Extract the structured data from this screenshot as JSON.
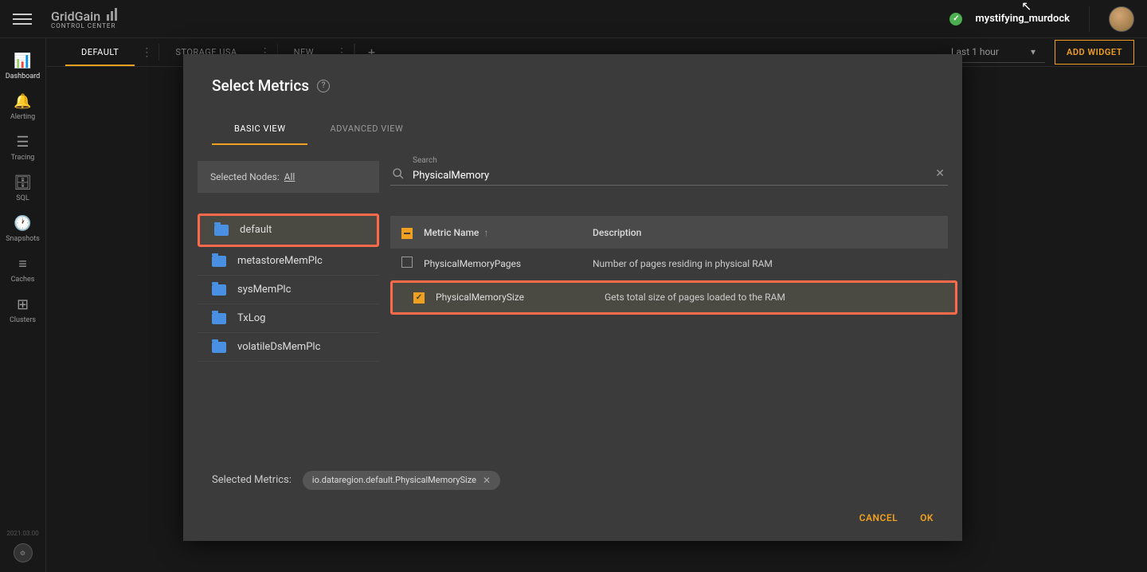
{
  "header": {
    "logo_main": "GridGain",
    "logo_sub": "CONTROL CENTER",
    "username": "mystifying_murdock"
  },
  "sidebar": {
    "items": [
      {
        "label": "Dashboard",
        "icon": "📊"
      },
      {
        "label": "Alerting",
        "icon": "🔔"
      },
      {
        "label": "Tracing",
        "icon": "☰"
      },
      {
        "label": "SQL",
        "icon": "🗄"
      },
      {
        "label": "Snapshots",
        "icon": "🕐"
      },
      {
        "label": "Caches",
        "icon": "≡"
      },
      {
        "label": "Clusters",
        "icon": "⊞"
      }
    ],
    "version": "2021.03.00"
  },
  "tabs": {
    "items": [
      {
        "label": "DEFAULT",
        "active": true
      },
      {
        "label": "STORAGE USA",
        "active": false
      },
      {
        "label": "NEW",
        "active": false
      }
    ],
    "time_range": "Last 1 hour",
    "add_widget": "ADD WIDGET"
  },
  "dialog": {
    "title": "Select Metrics",
    "tabs": {
      "basic": "BASIC VIEW",
      "advanced": "ADVANCED VIEW"
    },
    "selected_nodes_label": "Selected Nodes:",
    "selected_nodes_value": "All",
    "search_label": "Search",
    "search_value": "PhysicalMemory",
    "folders": [
      {
        "name": "default",
        "active": true
      },
      {
        "name": "metastoreMemPlc",
        "active": false
      },
      {
        "name": "sysMemPlc",
        "active": false
      },
      {
        "name": "TxLog",
        "active": false
      },
      {
        "name": "volatileDsMemPlc",
        "active": false
      }
    ],
    "table": {
      "col_name": "Metric Name",
      "col_desc": "Description",
      "rows": [
        {
          "name": "PhysicalMemoryPages",
          "desc": "Number of pages residing in physical RAM",
          "checked": false
        },
        {
          "name": "PhysicalMemorySize",
          "desc": "Gets total size of pages loaded to the RAM",
          "checked": true
        }
      ]
    },
    "selected_metrics_label": "Selected Metrics:",
    "chip_value": "io.dataregion.default.PhysicalMemorySize",
    "cancel": "CANCEL",
    "ok": "OK"
  }
}
